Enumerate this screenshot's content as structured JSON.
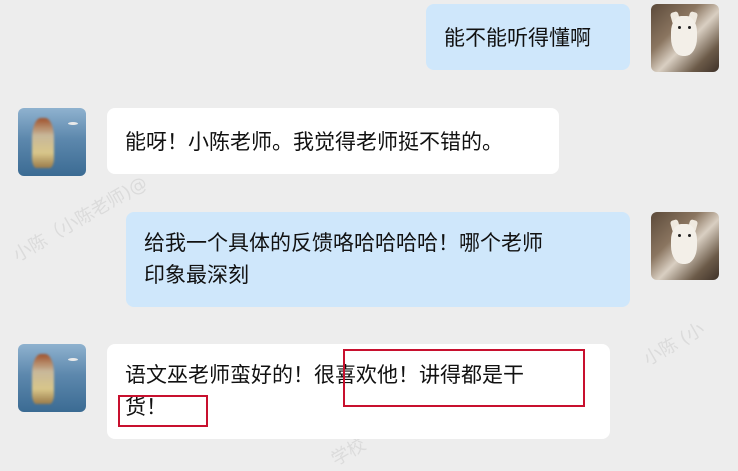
{
  "messages": [
    {
      "side": "out",
      "text": "能不能听得懂啊"
    },
    {
      "side": "in",
      "text": "能呀！小陈老师。我觉得老师挺不错的。"
    },
    {
      "side": "out",
      "lines": [
        "给我一个具体的反馈咯哈哈哈哈！哪个老师",
        "印象最深刻"
      ]
    },
    {
      "side": "in",
      "lines": [
        "语文巫老师蛮好的！很喜欢他！讲得都是干",
        "货！"
      ]
    }
  ],
  "watermarks": [
    "小陈（小陈老师)@",
    "小陈 (小",
    "学校"
  ],
  "colors": {
    "background": "#ededed",
    "outgoing_bubble": "#cfe7fb",
    "incoming_bubble": "#ffffff",
    "highlight_box": "#c8102e"
  },
  "icons": {
    "self_avatar": "dog-avatar-icon",
    "contact_avatar": "contact-avatar-icon"
  }
}
